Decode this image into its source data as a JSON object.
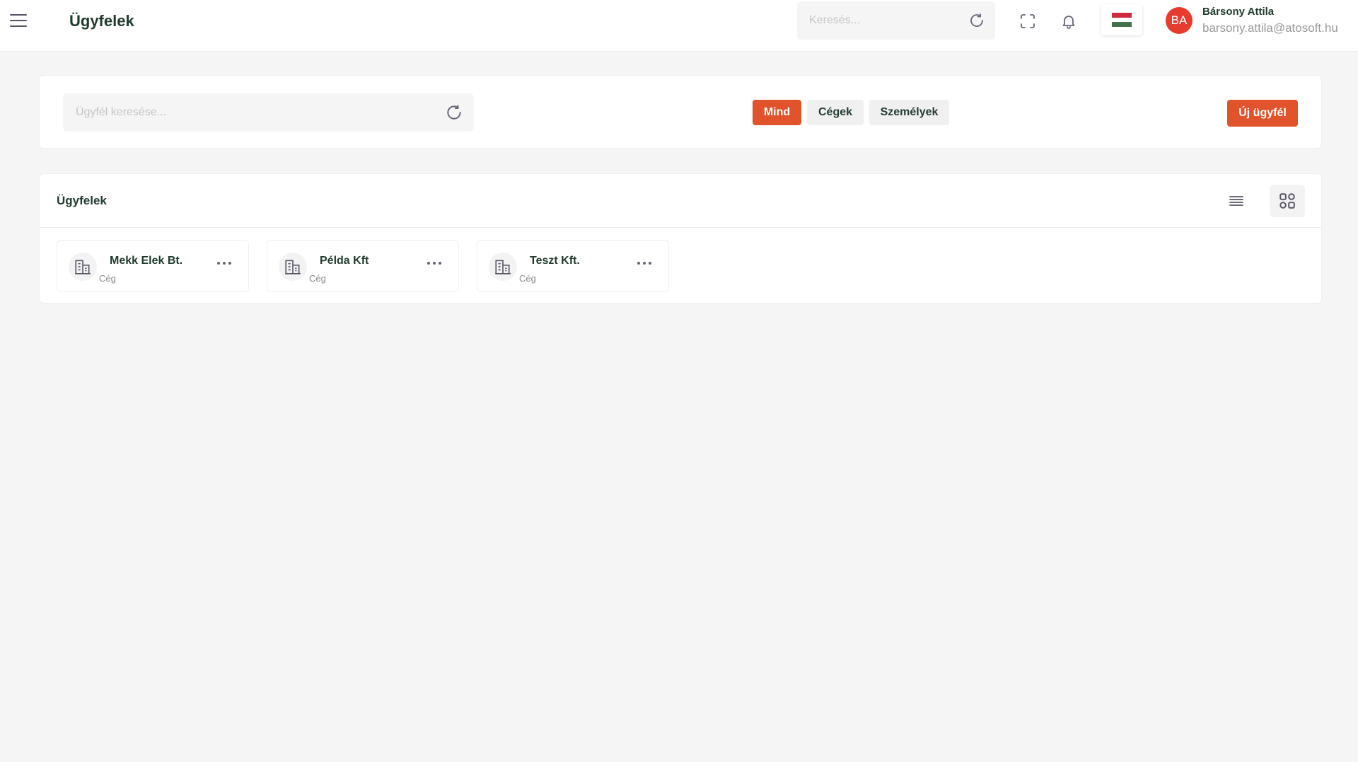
{
  "header": {
    "title": "Ügyfelek",
    "search_placeholder": "Keresés...",
    "user": {
      "initials": "BA",
      "name": "Bársony Attila",
      "email": "barsony.attila@atosoft.hu"
    },
    "flag_colors": [
      "#cd2a3e",
      "#ffffff",
      "#436f4d"
    ]
  },
  "filters": {
    "search_placeholder": "Ügyfél keresése...",
    "segments": [
      "Mind",
      "Cégek",
      "Személyek"
    ],
    "active_segment": "Mind",
    "new_button": "Új ügyfél"
  },
  "clients": {
    "title": "Ügyfelek",
    "view_mode": "grid",
    "items": [
      {
        "name": "Mekk Elek Bt.",
        "type": "Cég"
      },
      {
        "name": "Példa Kft",
        "type": "Cég"
      },
      {
        "name": "Teszt Kft.",
        "type": "Cég"
      }
    ]
  },
  "colors": {
    "accent": "#e0532b",
    "text": "#1f3b2d",
    "avatar": "#e63b2e"
  }
}
